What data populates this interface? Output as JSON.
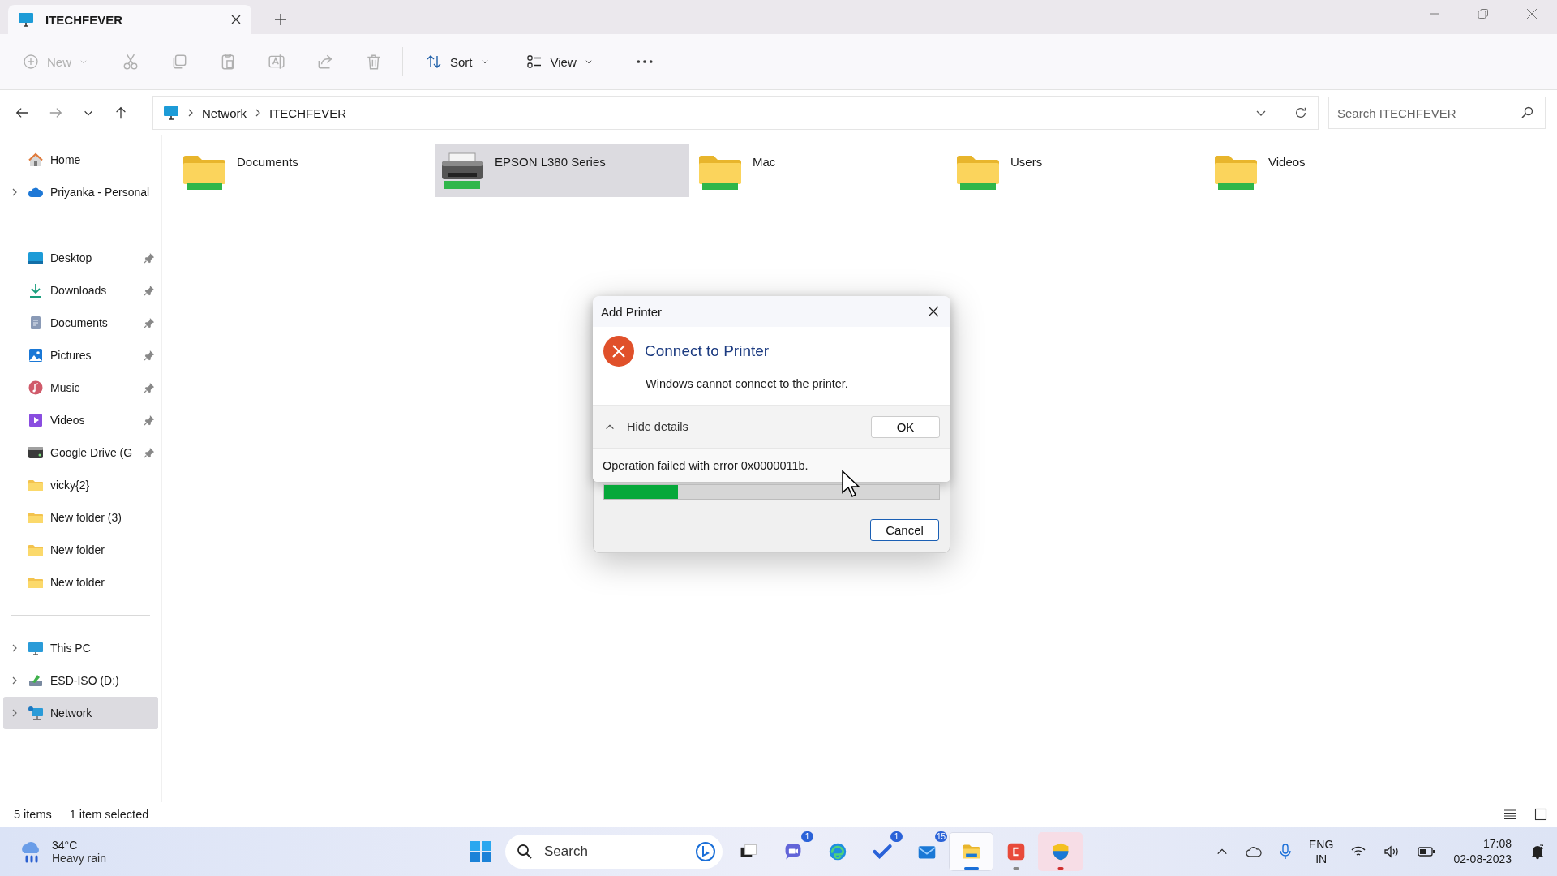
{
  "window": {
    "tabs": [
      {
        "label": "ITECHFEVER",
        "selected": true
      }
    ]
  },
  "toolbar": [
    {
      "kind": "dropdown",
      "label": "New",
      "disabled": true
    },
    {
      "kind": "button",
      "disabled": true
    },
    {
      "kind": "button",
      "disabled": true
    },
    {
      "kind": "button",
      "disabled": true
    },
    {
      "kind": "button",
      "disabled": true
    },
    {
      "kind": "button",
      "disabled": true
    },
    {
      "kind": "button",
      "disabled": true
    },
    {
      "kind": "separator"
    },
    {
      "kind": "dropdown",
      "label": "Sort",
      "disabled": false
    },
    {
      "kind": "dropdown",
      "label": "View",
      "disabled": false
    },
    {
      "kind": "separator"
    },
    {
      "kind": "button",
      "disabled": false
    }
  ],
  "address": {
    "path": [
      "Network",
      "ITECHFEVER"
    ],
    "search": {
      "placeholder": "Search ITECHFEVER"
    }
  },
  "sidebar": {
    "groups": [
      [
        {
          "label": "Home",
          "expandable": false,
          "pinned": false,
          "selected": false
        },
        {
          "label": "Priyanka - Personal",
          "expandable": true,
          "pinned": false,
          "selected": false
        }
      ],
      [
        {
          "label": "Desktop",
          "expandable": false,
          "pinned": true,
          "selected": false
        },
        {
          "label": "Downloads",
          "expandable": false,
          "pinned": true,
          "selected": false
        },
        {
          "label": "Documents",
          "expandable": false,
          "pinned": true,
          "selected": false
        },
        {
          "label": "Pictures",
          "expandable": false,
          "pinned": true,
          "selected": false
        },
        {
          "label": "Music",
          "expandable": false,
          "pinned": true,
          "selected": false
        },
        {
          "label": "Videos",
          "expandable": false,
          "pinned": true,
          "selected": false
        },
        {
          "label": "Google Drive (G",
          "expandable": false,
          "pinned": true,
          "selected": false
        },
        {
          "label": "vicky{2}",
          "expandable": false,
          "pinned": false,
          "selected": false
        },
        {
          "label": "New folder (3)",
          "expandable": false,
          "pinned": false,
          "selected": false
        },
        {
          "label": "New folder",
          "expandable": false,
          "pinned": false,
          "selected": false
        },
        {
          "label": "New folder",
          "expandable": false,
          "pinned": false,
          "selected": false
        }
      ],
      [
        {
          "label": "This PC",
          "expandable": true,
          "pinned": false,
          "selected": false
        },
        {
          "label": "ESD-ISO (D:)",
          "expandable": true,
          "pinned": false,
          "selected": false
        },
        {
          "label": "Network",
          "expandable": true,
          "pinned": false,
          "selected": true
        }
      ]
    ]
  },
  "files": [
    {
      "name": "Documents",
      "kind": "folder",
      "selected": false
    },
    {
      "name": "EPSON L380 Series",
      "kind": "printer",
      "selected": true
    },
    {
      "name": "Mac",
      "kind": "folder",
      "selected": false
    },
    {
      "name": "Users",
      "kind": "folder",
      "selected": false
    },
    {
      "name": "Videos",
      "kind": "folder",
      "selected": false
    }
  ],
  "dialog": {
    "title": "Add Printer",
    "heading": "Connect to Printer",
    "message": "Windows cannot connect to the printer.",
    "details_toggle": {
      "label": "Hide details",
      "expanded": true
    },
    "ok": "OK",
    "details": "Operation failed with error 0x0000011b.",
    "progress": {
      "level": 0.22
    },
    "cancel": "Cancel"
  },
  "status_bar": {
    "count": "5 items",
    "selection": "1 item selected"
  },
  "taskbar": {
    "weather": {
      "temperature": "34°C",
      "condition": "Heavy rain"
    },
    "search": {
      "placeholder": "Search"
    },
    "apps": [
      {
        "running": false,
        "active": false,
        "alert": false
      },
      {
        "running": false,
        "active": false,
        "alert": false,
        "badge": "1"
      },
      {
        "running": false,
        "active": false,
        "alert": false
      },
      {
        "running": false,
        "active": false,
        "alert": false,
        "badge": "1"
      },
      {
        "running": false,
        "active": false,
        "alert": false,
        "badge": "15"
      },
      {
        "running": true,
        "active": true,
        "alert": false
      },
      {
        "running": true,
        "active": false,
        "alert": false
      },
      {
        "running": true,
        "active": false,
        "alert": true
      }
    ],
    "tray": {
      "language": "ENG",
      "region": "IN",
      "time": "17:08",
      "date": "02-08-2023"
    }
  }
}
